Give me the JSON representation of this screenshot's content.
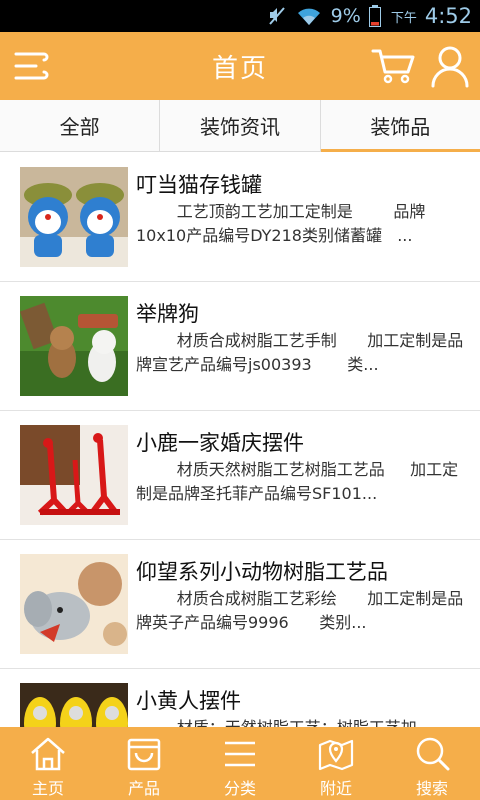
{
  "status_bar": {
    "battery_percent": "9%",
    "ampm": "下午",
    "time": "4:52"
  },
  "header": {
    "title": "首页"
  },
  "tabs": [
    {
      "label": "全部",
      "active": false
    },
    {
      "label": "装饰资讯",
      "active": false
    },
    {
      "label": "装饰品",
      "active": true
    }
  ],
  "items": [
    {
      "name": "叮当猫存钱罐",
      "desc": "        工艺顶韵工艺加工定制是        品牌10x10产品编号DY218类别储蓄罐   ..."
    },
    {
      "name": "举牌狗",
      "desc": "        材质合成树脂工艺手制      加工定制是品牌宣艺产品编号js00393       类..."
    },
    {
      "name": "小鹿一家婚庆摆件",
      "desc": "        材质天然树脂工艺树脂工艺品     加工定制是品牌圣托菲产品编号SF101..."
    },
    {
      "name": "仰望系列小动物树脂工艺品",
      "desc": "        材质合成树脂工艺彩绘      加工定制是品牌英子产品编号9996      类别..."
    },
    {
      "name": "小黄人摆件",
      "desc": "        材质：天然树脂工艺：树脂工艺加"
    }
  ],
  "bottom_nav": [
    {
      "label": "主页",
      "icon": "home-icon"
    },
    {
      "label": "产品",
      "icon": "bag-icon"
    },
    {
      "label": "分类",
      "icon": "menu-lines-icon"
    },
    {
      "label": "附近",
      "icon": "map-icon"
    },
    {
      "label": "搜索",
      "icon": "search-icon"
    }
  ],
  "colors": {
    "accent": "#f5ae4a",
    "status_text": "#9ecbe8"
  }
}
